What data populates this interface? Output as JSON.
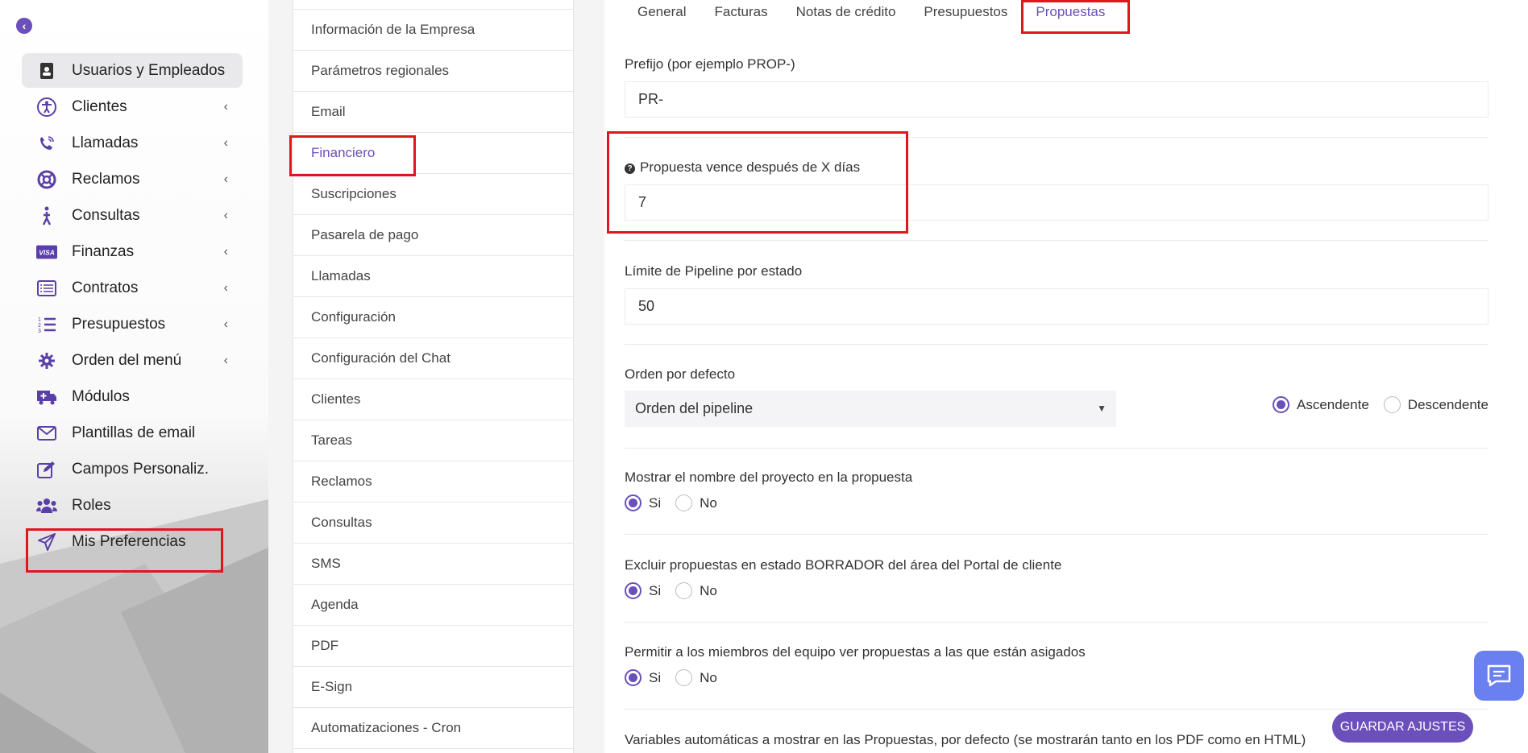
{
  "sidebar": {
    "items": [
      {
        "label": "Usuarios y Empleados",
        "icon": "contact-book-icon",
        "chevron": false,
        "active": true
      },
      {
        "label": "Clientes",
        "icon": "accessibility-icon",
        "chevron": true
      },
      {
        "label": "Llamadas",
        "icon": "phone-volume-icon",
        "chevron": true
      },
      {
        "label": "Reclamos",
        "icon": "life-ring-icon",
        "chevron": true
      },
      {
        "label": "Consultas",
        "icon": "walking-person-icon",
        "chevron": true
      },
      {
        "label": "Finanzas",
        "icon": "visa-card-icon",
        "chevron": true
      },
      {
        "label": "Contratos",
        "icon": "list-window-icon",
        "chevron": true
      },
      {
        "label": "Presupuestos",
        "icon": "numbered-list-icon",
        "chevron": true
      },
      {
        "label": "Orden del menú",
        "icon": "gear-icon",
        "chevron": true
      },
      {
        "label": "Módulos",
        "icon": "truck-medical-icon",
        "chevron": false
      },
      {
        "label": "Plantillas de email",
        "icon": "envelope-icon",
        "chevron": false
      },
      {
        "label": "Campos Personaliz.",
        "icon": "edit-icon",
        "chevron": false
      },
      {
        "label": "Roles",
        "icon": "users-icon",
        "chevron": false
      },
      {
        "label": "Mis Preferencias",
        "icon": "paper-plane-icon",
        "chevron": false
      }
    ]
  },
  "menu": {
    "items": [
      "Información de la Empresa",
      "Parámetros regionales",
      "Email",
      "Financiero",
      "Suscripciones",
      "Pasarela de pago",
      "Llamadas",
      "Configuración",
      "Configuración del Chat",
      "Clientes",
      "Tareas",
      "Reclamos",
      "Consultas",
      "SMS",
      "Agenda",
      "PDF",
      "E-Sign",
      "Automatizaciones - Cron"
    ],
    "active": "Financiero"
  },
  "tabs": [
    "General",
    "Facturas",
    "Notas de crédito",
    "Presupuestos",
    "Propuestas"
  ],
  "active_tab": "Propuestas",
  "form": {
    "prefix_label": "Prefijo (por ejemplo PROP-)",
    "prefix_value": "PR-",
    "expiry_label": "Propuesta vence después de X días",
    "expiry_value": "7",
    "pipeline_label": "Límite de Pipeline por estado",
    "pipeline_value": "50",
    "order_label": "Orden por defecto",
    "order_value": "Orden del pipeline",
    "asc_label": "Ascendente",
    "desc_label": "Descendente",
    "show_project_label": "Mostrar el nombre del proyecto en la propuesta",
    "exclude_draft_label": "Excluir propuestas en estado BORRADOR del área del Portal de cliente",
    "team_members_label": "Permitir a los miembros del equipo ver propuestas a las que están asigados",
    "vars_label": "Variables automáticas a mostrar en las Propuestas, por defecto (se mostrarán tanto en los PDF como en HTML)",
    "yes": "Si",
    "no": "No"
  },
  "save_label": "GUARDAR AJUSTES",
  "colors": {
    "accent": "#6b4fbb",
    "highlight_box": "#e0161f",
    "chat": "#6a7ff0"
  }
}
